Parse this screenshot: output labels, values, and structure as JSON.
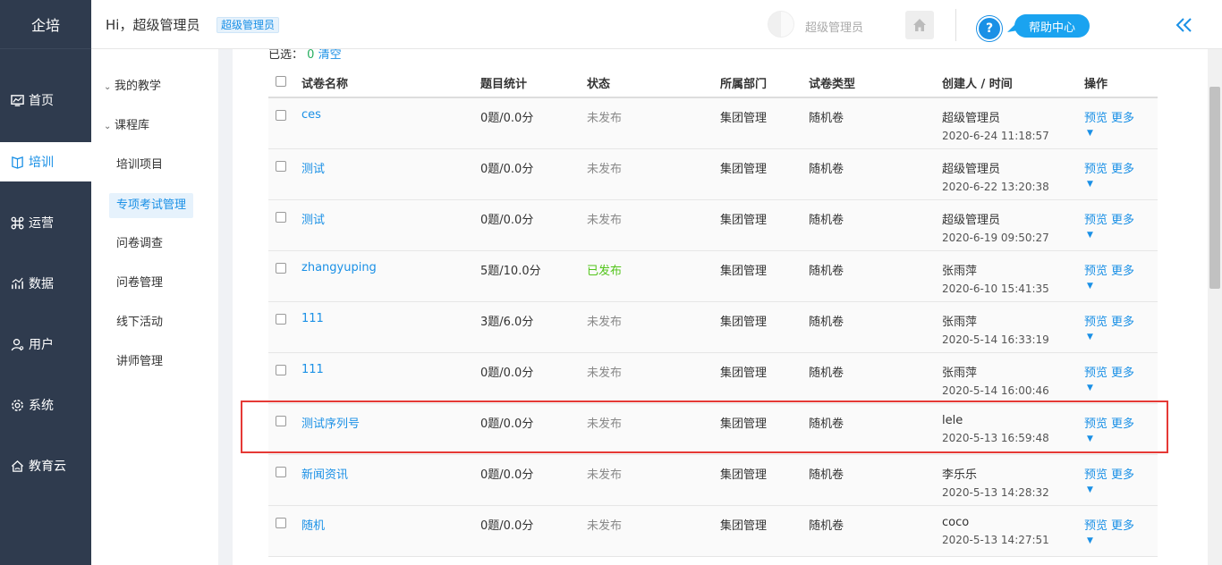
{
  "brand": "企培",
  "nav": [
    {
      "label": "首页",
      "icon": "dashboard-icon"
    },
    {
      "label": "培训",
      "icon": "book-icon"
    },
    {
      "label": "运营",
      "icon": "command-icon"
    },
    {
      "label": "数据",
      "icon": "chart-icon"
    },
    {
      "label": "用户",
      "icon": "user-icon"
    },
    {
      "label": "系统",
      "icon": "gear-icon"
    },
    {
      "label": "教育云",
      "icon": "cloud-home-icon"
    }
  ],
  "header": {
    "greeting": "Hi，超级管理员",
    "role_tag": "超级管理员",
    "user_name": "超级管理员",
    "help_label": "帮助中心",
    "help_icon_text": "?"
  },
  "submenu": {
    "group1": "我的教学",
    "group2": "课程库",
    "items": [
      "培训项目",
      "专项考试管理",
      "问卷调查",
      "问卷管理",
      "线下活动",
      "讲师管理"
    ]
  },
  "selection": {
    "label": "已选：",
    "count": "0",
    "clear": "清空"
  },
  "table": {
    "headers": [
      "试卷名称",
      "题目统计",
      "状态",
      "所属部门",
      "试卷类型",
      "创建人 / 时间",
      "操作"
    ],
    "preview_label": "预览",
    "more_label": "更多",
    "rows": [
      {
        "name": "ces",
        "stats": "0题/0.0分",
        "status": "未发布",
        "dept": "集团管理",
        "type": "随机卷",
        "creator": "超级管理员",
        "time": "2020-6-24 11:18:57"
      },
      {
        "name": "测试",
        "stats": "0题/0.0分",
        "status": "未发布",
        "dept": "集团管理",
        "type": "随机卷",
        "creator": "超级管理员",
        "time": "2020-6-22 13:20:38"
      },
      {
        "name": "测试",
        "stats": "0题/0.0分",
        "status": "未发布",
        "dept": "集团管理",
        "type": "随机卷",
        "creator": "超级管理员",
        "time": "2020-6-19 09:50:27"
      },
      {
        "name": "zhangyuping",
        "stats": "5题/10.0分",
        "status": "已发布",
        "dept": "集团管理",
        "type": "随机卷",
        "creator": "张雨萍",
        "time": "2020-6-10 15:41:35"
      },
      {
        "name": "111",
        "stats": "3题/6.0分",
        "status": "未发布",
        "dept": "集团管理",
        "type": "随机卷",
        "creator": "张雨萍",
        "time": "2020-5-14 16:33:19"
      },
      {
        "name": "111",
        "stats": "0题/0.0分",
        "status": "未发布",
        "dept": "集团管理",
        "type": "随机卷",
        "creator": "张雨萍",
        "time": "2020-5-14 16:00:46"
      },
      {
        "name": "测试序列号",
        "stats": "0题/0.0分",
        "status": "未发布",
        "dept": "集团管理",
        "type": "随机卷",
        "creator": "lele",
        "time": "2020-5-13 16:59:48"
      },
      {
        "name": "新闻资讯",
        "stats": "0题/0.0分",
        "status": "未发布",
        "dept": "集团管理",
        "type": "随机卷",
        "creator": "李乐乐",
        "time": "2020-5-13 14:28:32"
      },
      {
        "name": "随机",
        "stats": "0题/0.0分",
        "status": "未发布",
        "dept": "集团管理",
        "type": "随机卷",
        "creator": "coco",
        "time": "2020-5-13 14:27:51"
      }
    ]
  },
  "colors": {
    "sidebar": "#2f3b4e",
    "accent": "#1a90e6",
    "published": "#52c41a",
    "highlight": "#e53935"
  }
}
